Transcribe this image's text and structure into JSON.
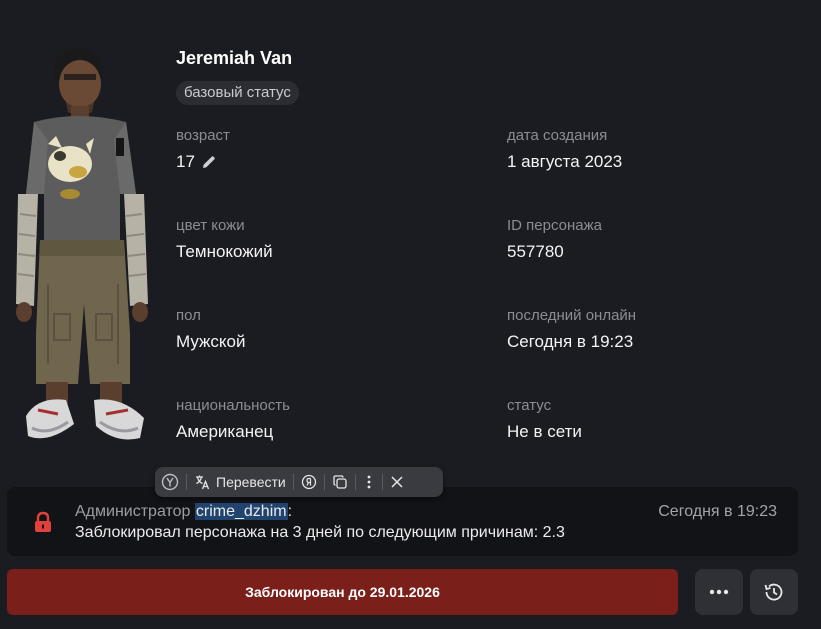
{
  "character": {
    "name": "Jeremiah Van",
    "status_badge": "базовый статус"
  },
  "fields": {
    "age": {
      "label": "возраст",
      "value": "17"
    },
    "created": {
      "label": "дата создания",
      "value": "1 августа 2023"
    },
    "skin": {
      "label": "цвет кожи",
      "value": "Темнокожий"
    },
    "id": {
      "label": "ID персонажа",
      "value": "557780"
    },
    "gender": {
      "label": "пол",
      "value": "Мужской"
    },
    "last_online": {
      "label": "последний онлайн",
      "value": "Сегодня в 19:23"
    },
    "nationality": {
      "label": "национальность",
      "value": "Американец"
    },
    "status": {
      "label": "статус",
      "value": "Не в сети"
    }
  },
  "translate_toolbar": {
    "translate_label": "Перевести"
  },
  "log": {
    "prefix": "Администратор",
    "user": "crime_dzhim",
    "colon": ":",
    "message": "Заблокировал персонажа на 3 дней по следующим причинам: 2.3",
    "time": "Сегодня в 19:23"
  },
  "ban_button": {
    "label": "Заблокирован до 29.01.2026"
  },
  "colors": {
    "background": "#1b1c21",
    "ban_button": "#7a1f1a",
    "lock_icon": "#e0413a",
    "selection": "#21446e"
  },
  "icons": [
    "edit-pencil-icon",
    "yandex-logo-icon",
    "translate-icon",
    "yandex-search-icon",
    "copy-icon",
    "more-vertical-icon",
    "close-icon",
    "lock-icon",
    "more-horizontal-icon",
    "history-icon"
  ]
}
